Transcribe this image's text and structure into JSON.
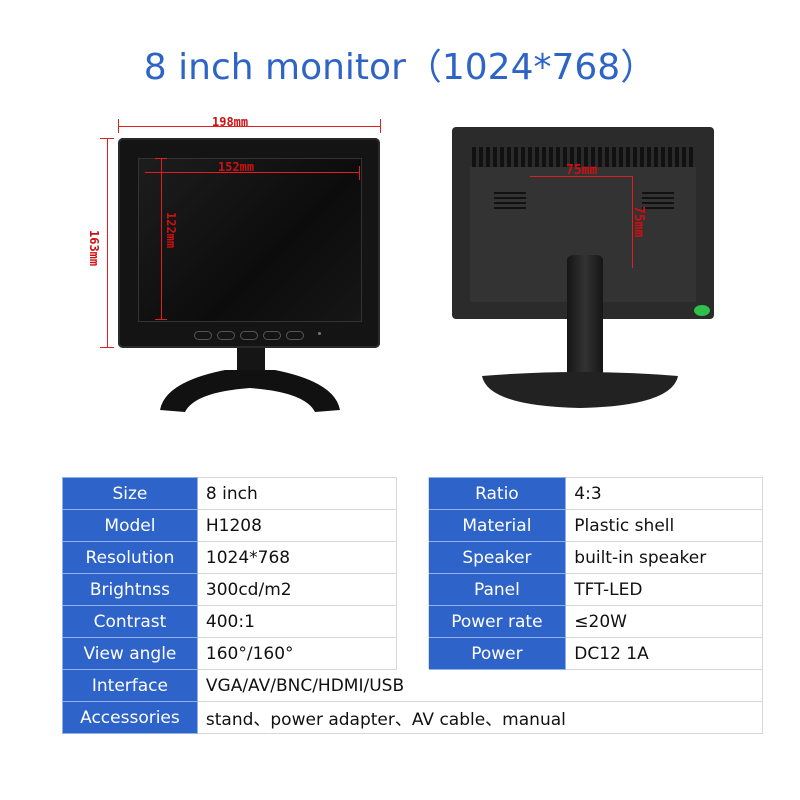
{
  "title": "8 inch monitor（1024*768）",
  "front_view": {
    "dimensions": {
      "outer_width": "198mm",
      "outer_height": "163mm",
      "screen_width": "152mm",
      "screen_height": "122mm"
    },
    "front_buttons_count": 5
  },
  "back_view": {
    "vesa_horizontal": "75mm",
    "vesa_vertical": "75mm"
  },
  "spec_table": {
    "left": [
      {
        "label": "Size",
        "value": "8 inch"
      },
      {
        "label": "Model",
        "value": "H1208"
      },
      {
        "label": "Resolution",
        "value": "1024*768"
      },
      {
        "label": "Brightnss",
        "value": "300cd/m2"
      },
      {
        "label": "Contrast",
        "value": "400:1"
      },
      {
        "label": "View angle",
        "value": "160°/160°"
      }
    ],
    "right": [
      {
        "label": "Ratio",
        "value": "4:3"
      },
      {
        "label": "Material",
        "value": "Plastic shell"
      },
      {
        "label": "Speaker",
        "value": "built-in speaker"
      },
      {
        "label": "Panel",
        "value": "TFT-LED"
      },
      {
        "label": "Power rate",
        "value": "≤20W"
      },
      {
        "label": "Power",
        "value": "DC12  1A"
      }
    ],
    "full": [
      {
        "label": "Interface",
        "value": "VGA/AV/BNC/HDMI/USB"
      },
      {
        "label": "Accessories",
        "value": "stand、power adapter、AV cable、manual"
      }
    ]
  },
  "colors": {
    "accent_blue": "#2e63c9",
    "title_blue": "#2f64c7",
    "dimension_red": "#e02020"
  }
}
